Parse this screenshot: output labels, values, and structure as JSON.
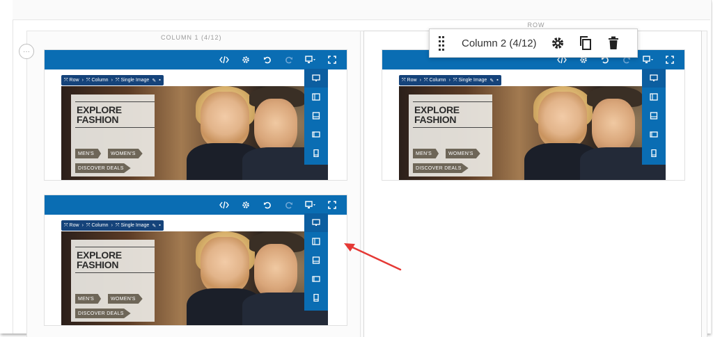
{
  "row": {
    "label": "ROW"
  },
  "column1": {
    "label": "COLUMN 1 (4/12)",
    "more_label": "···"
  },
  "column_toolbar": {
    "label": "Column 2 (4/12)"
  },
  "breadcrumb": {
    "row": "Row",
    "column": "Column",
    "element": "Single Image"
  },
  "banner": {
    "title": "EXPLORE FASHION",
    "mens": "MEN'S",
    "womens": "WOMEN'S",
    "deals": "DISCOVER DEALS"
  },
  "colors": {
    "accent": "#0a6db3",
    "breadcrumb_bg": "#15437a",
    "arrow": "#e53935"
  },
  "icons": [
    "code-icon",
    "gear-icon",
    "undo-icon",
    "redo-icon",
    "responsive-icon",
    "fullscreen-icon",
    "desktop-icon",
    "tablet-landscape-icon",
    "tablet-portrait-icon",
    "mobile-landscape-icon",
    "mobile-portrait-icon",
    "drag-handle-icon",
    "copy-icon",
    "trash-icon"
  ]
}
